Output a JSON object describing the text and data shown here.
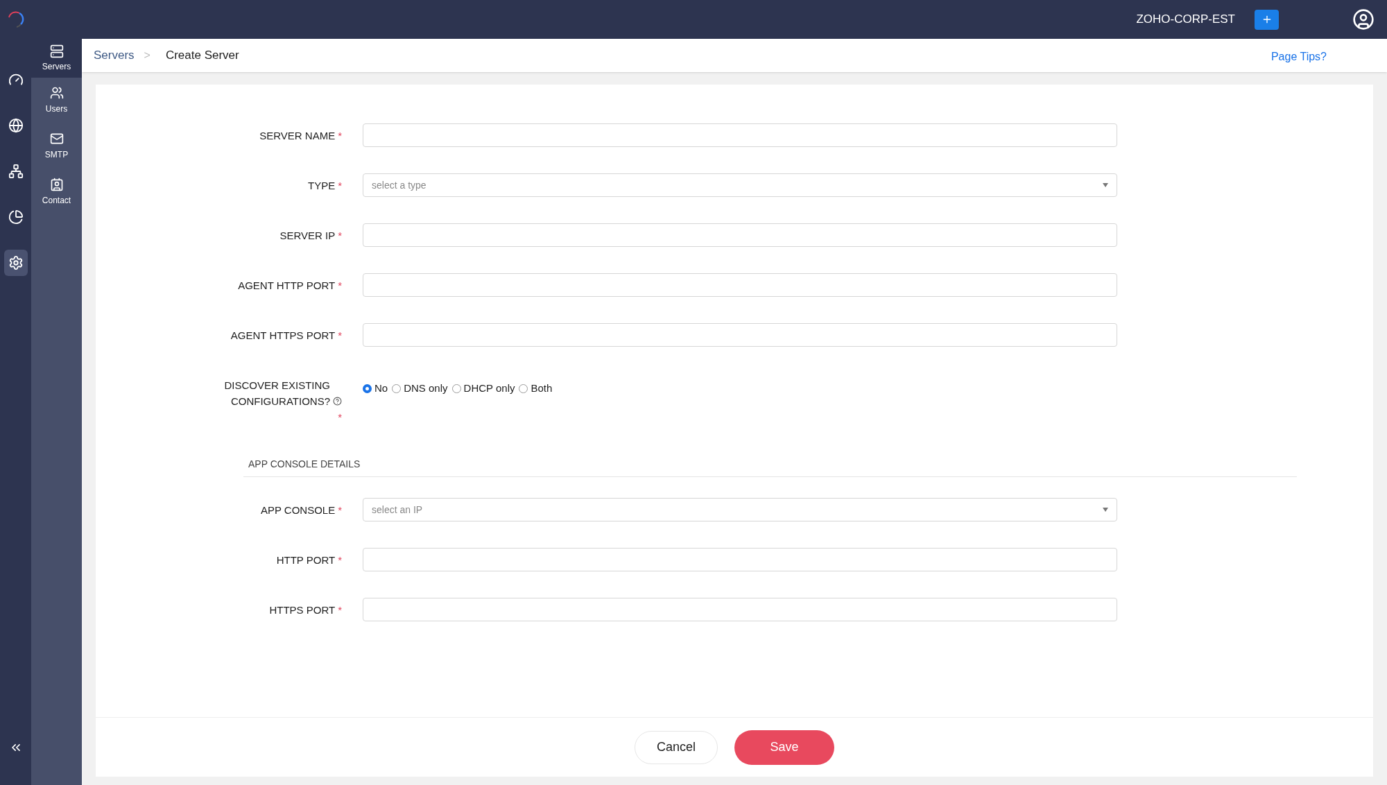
{
  "topbar": {
    "org": "ZOHO-CORP-EST"
  },
  "rail": [
    {
      "kind": "dashboard",
      "selected": false
    },
    {
      "kind": "dns",
      "selected": false
    },
    {
      "kind": "topology",
      "selected": false
    },
    {
      "kind": "reports",
      "selected": false
    },
    {
      "kind": "settings",
      "selected": true
    }
  ],
  "subnav": [
    {
      "kind": "servers",
      "label": "Servers",
      "selected": true
    },
    {
      "kind": "users",
      "label": "Users",
      "selected": false
    },
    {
      "kind": "smtp",
      "label": "SMTP",
      "selected": false
    },
    {
      "kind": "contact",
      "label": "Contact",
      "selected": false
    }
  ],
  "breadcrumb": {
    "parent": "Servers",
    "separator": ">",
    "current": "Create Server"
  },
  "page_tips": "Page Tips?",
  "sections": [
    {
      "fields": [
        {
          "kind": "text",
          "label": "SERVER NAME",
          "required_mark": "*"
        },
        {
          "kind": "select",
          "label": "TYPE",
          "required_mark": "*",
          "placeholder": "select a type"
        },
        {
          "kind": "text",
          "label": "SERVER IP",
          "required_mark": "*"
        },
        {
          "kind": "text",
          "label": "AGENT HTTP PORT",
          "required_mark": "*"
        },
        {
          "kind": "text",
          "label": "AGENT HTTPS PORT",
          "required_mark": "*"
        },
        {
          "kind": "radio",
          "label": "DISCOVER EXISTING CONFIGURATIONS?",
          "required_mark": "*",
          "help": true,
          "options": [
            {
              "label": "No",
              "selected": true
            },
            {
              "label": "DNS only",
              "selected": false
            },
            {
              "label": "DHCP only",
              "selected": false
            },
            {
              "label": "Both",
              "selected": false
            }
          ]
        }
      ]
    },
    {
      "heading": "APP CONSOLE DETAILS",
      "fields": [
        {
          "kind": "select",
          "label": "APP CONSOLE",
          "required_mark": "*",
          "placeholder": "select an IP"
        },
        {
          "kind": "text",
          "label": "HTTP PORT",
          "required_mark": "*"
        },
        {
          "kind": "text",
          "label": "HTTPS PORT",
          "required_mark": "*"
        }
      ]
    }
  ],
  "buttons": {
    "cancel": "Cancel",
    "save": "Save"
  }
}
